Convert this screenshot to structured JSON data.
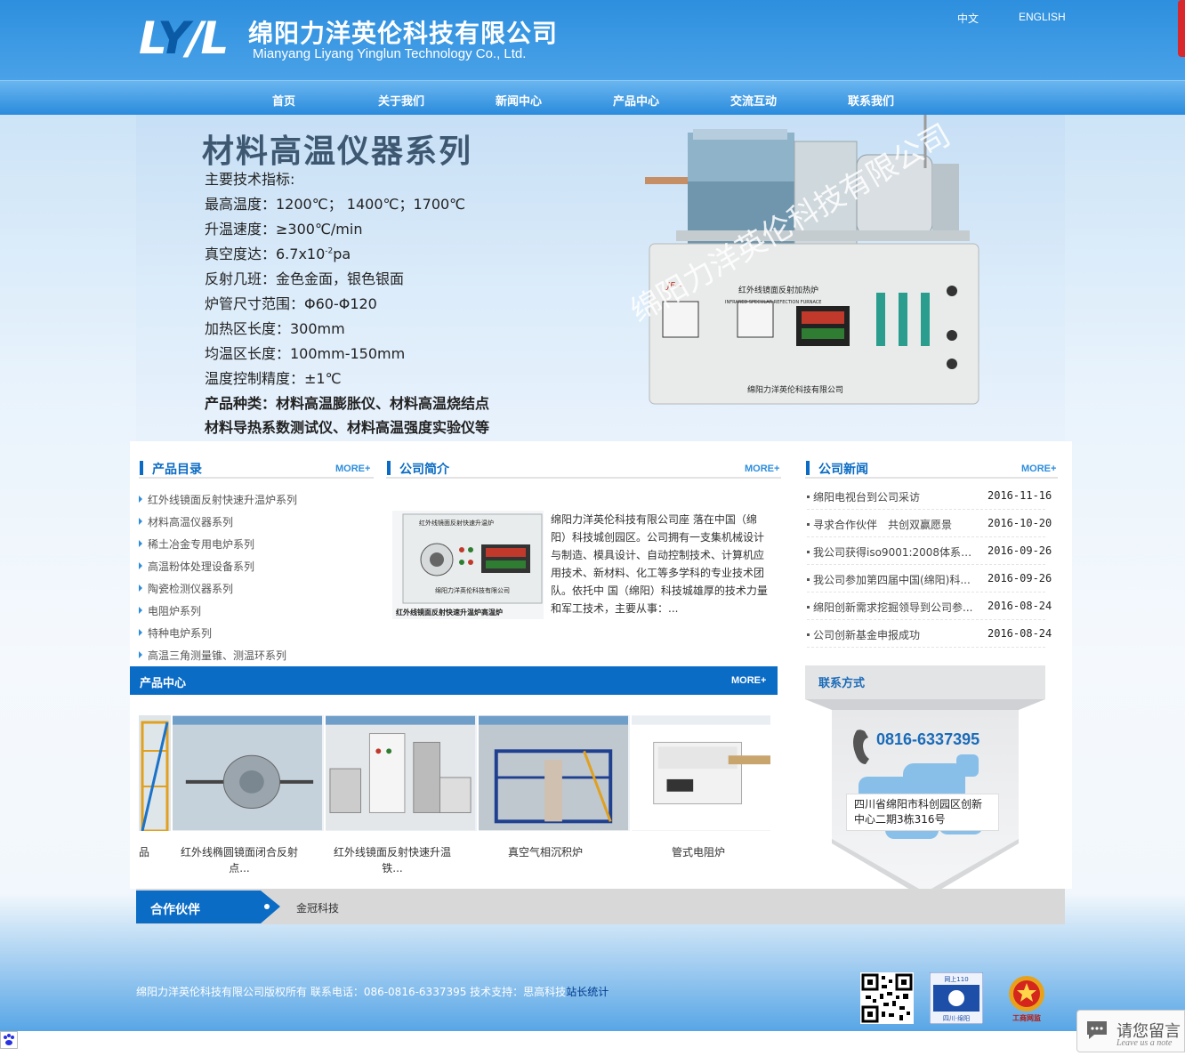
{
  "header": {
    "logo_text": "LYYL",
    "company_cn": "绵阳力洋英伦科技有限公司",
    "company_en": "Mianyang Liyang Yinglun Technology Co., Ltd.",
    "lang_cn": "中文",
    "lang_en": "ENGLISH"
  },
  "nav": [
    "首页",
    "关于我们",
    "新闻中心",
    "产品中心",
    "交流互动",
    "联系我们"
  ],
  "banner": {
    "title": "材料高温仪器系列",
    "lines": [
      "主要技术指标:",
      "最高温度：1200℃； 1400℃；1700℃",
      "升温速度：≥300℃/min",
      "真空度达：6.7x10",
      "反射几班：金色金面，银色银面",
      "炉管尺寸范围：Φ60-Φ120",
      "加热区长度：300mm",
      "均温区长度：100mm-150mm",
      "温度控制精度：±1℃"
    ],
    "vacuum_exp": "-2",
    "vacuum_unit": "pa",
    "bold_lines": [
      "产品种类：材料高温膨胀仪、材料高温烧结点",
      "材料导热系数测试仪、材料高温强度实验仪等"
    ],
    "watermark": "绵阳力洋英伦科技有限公司",
    "machine_label": "红外线镜面反射加热炉",
    "machine_label_en": "INFRARED SPECULAR REFECTION FURNACE",
    "machine_brand": "绵阳力洋英伦科技有限公司",
    "machine_model": "JF—"
  },
  "catalog": {
    "title": "产品目录",
    "more": "MORE+",
    "items": [
      "红外线镜面反射快速升温炉系列",
      "材料高温仪器系列",
      "稀土冶金专用电炉系列",
      "高温粉体处理设备系列",
      "陶瓷检测仪器系列",
      "电阻炉系列",
      "特种电炉系列",
      "高温三角测量锥、测温环系列"
    ]
  },
  "intro": {
    "title": "公司简介",
    "more": "MORE+",
    "image_caption": "红外线镜面反射快速升温炉高温炉",
    "device_title": "红外线镜面反射快速升温炉",
    "device_brand": "绵阳力洋英伦科技有限公司",
    "text": "绵阳力洋英伦科技有限公司座 落在中国（绵阳）科技城创园区。公司拥有一支集机械设计与制造、模具设计、自动控制技术、计算机应用技术、新材料、化工等多学科的专业技术团队。依托中 国（绵阳）科技城雄厚的技术力量和军工技术，主要从事：..."
  },
  "news": {
    "title": "公司新闻",
    "more": "MORE+",
    "items": [
      {
        "title": "绵阳电视台到公司采访",
        "date": "2016-11-16"
      },
      {
        "title": "寻求合作伙伴　共创双赢愿景",
        "date": "2016-10-20"
      },
      {
        "title": "我公司获得iso9001:2008体系认...",
        "date": "2016-09-26"
      },
      {
        "title": "我公司参加第四届中国(绵阳)科...",
        "date": "2016-09-26"
      },
      {
        "title": "绵阳创新需求挖掘领导到公司参...",
        "date": "2016-08-24"
      },
      {
        "title": "公司创新基金申报成功",
        "date": "2016-08-24"
      }
    ]
  },
  "products": {
    "title": "产品中心",
    "more": "MORE+",
    "items": [
      {
        "name": "红外线椭圆镜面闭合反射点...",
        "partial": "品"
      },
      {
        "name": "红外线镜面反射快速升温铁..."
      },
      {
        "name": "真空气相沉积炉"
      },
      {
        "name": "管式电阻炉"
      }
    ]
  },
  "contact": {
    "title": "联系方式",
    "phone": "0816-6337395",
    "address": "四川省绵阳市科创园区创新中心二期3栋316号"
  },
  "partners": {
    "label": "合作伙伴",
    "links": [
      "金冠科技"
    ]
  },
  "footer": {
    "text": "绵阳力洋英伦科技有限公司版权所有 联系电话：086-0816-6337395 技术支持：思高科技",
    "stats_link": "站长统计",
    "badge1_top": "网上110",
    "badge1_bottom": "四川·绵阳",
    "badge2_label": "工商网监"
  },
  "message": {
    "cn": "请您留言",
    "en": "Leave us a note"
  },
  "colors": {
    "brand_blue": "#0b6cc6",
    "header_blue": "#2d8fde",
    "accent_red": "#d8282e"
  }
}
